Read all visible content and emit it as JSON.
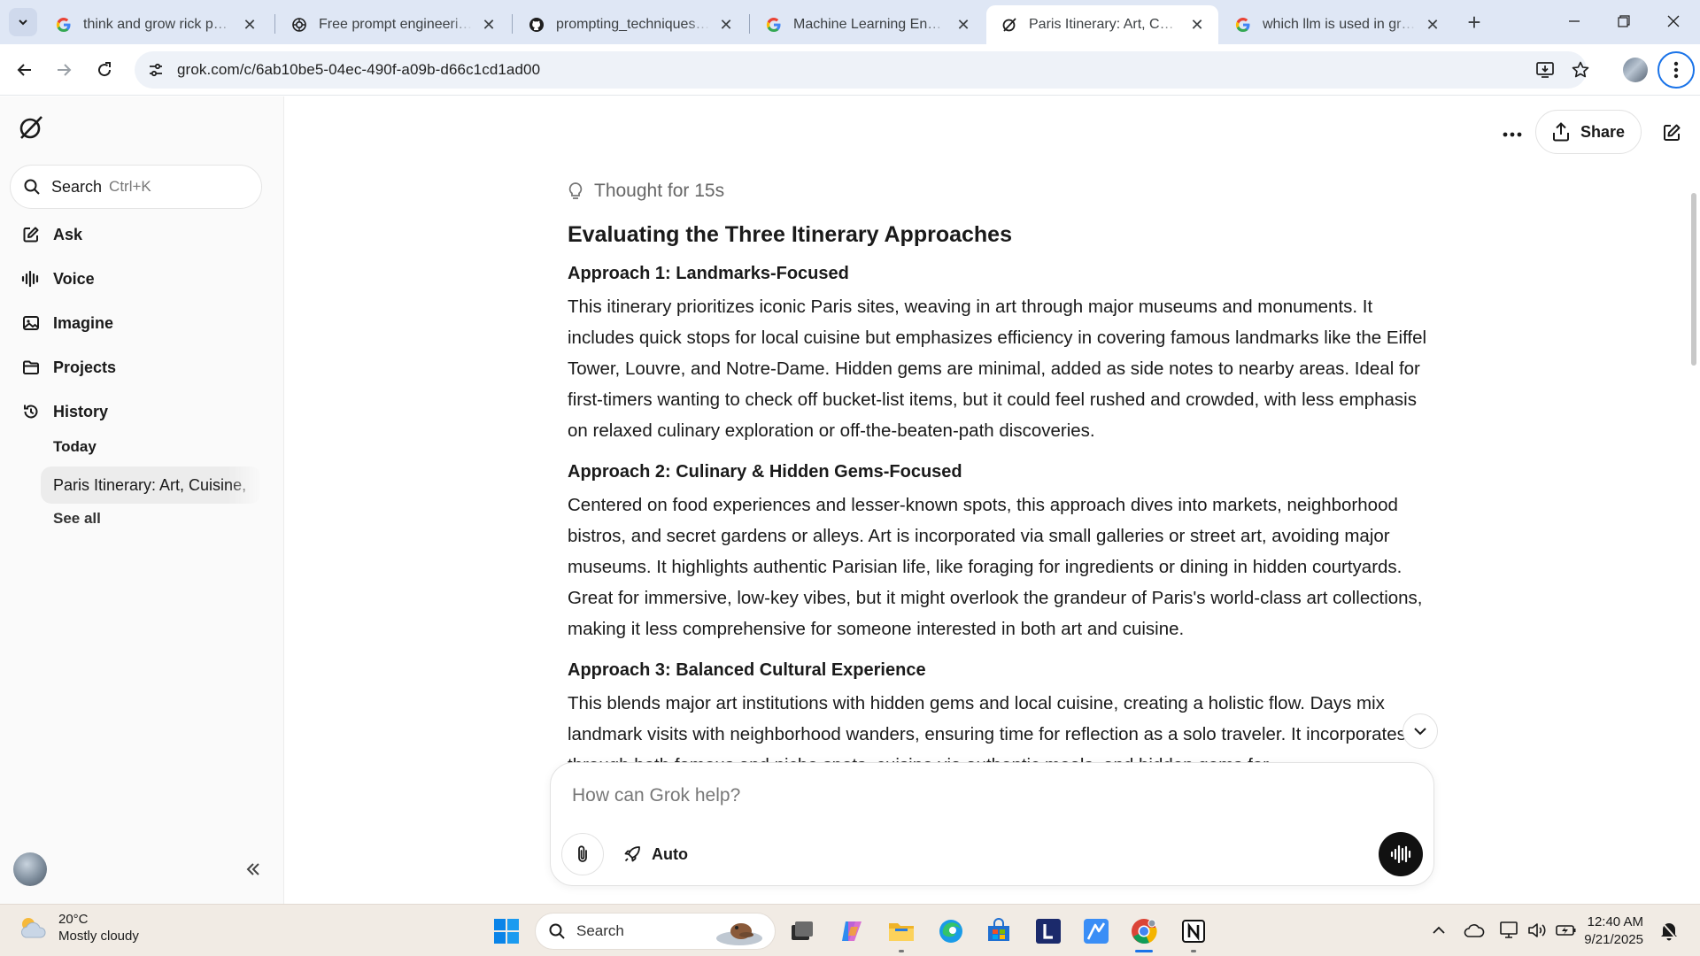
{
  "browser": {
    "tabs": [
      {
        "title": "think and grow rick pdf - G",
        "favicon": "google-icon"
      },
      {
        "title": "Free prompt engineering c",
        "favicon": "chatgpt-icon"
      },
      {
        "title": "prompting_techniques_on",
        "favicon": "github-icon"
      },
      {
        "title": "Machine Learning Enginee",
        "favicon": "google-icon"
      },
      {
        "title": "Paris Itinerary: Art, Cuisine,",
        "favicon": "grok-icon"
      },
      {
        "title": "which llm is used in grok -",
        "favicon": "google-icon"
      }
    ],
    "active_tab_index": 4,
    "url": "grok.com/c/6ab10be5-04ec-490f-a09b-d66c1cd1ad00"
  },
  "sidebar": {
    "search_label": "Search",
    "search_shortcut": "Ctrl+K",
    "nav": [
      {
        "label": "Ask",
        "icon": "ask-edit-icon"
      },
      {
        "label": "Voice",
        "icon": "voice-wave-icon"
      },
      {
        "label": "Imagine",
        "icon": "image-icon"
      },
      {
        "label": "Projects",
        "icon": "folder-icon"
      },
      {
        "label": "History",
        "icon": "history-icon"
      }
    ],
    "history": {
      "group": "Today",
      "items": [
        "Paris Itinerary: Art, Cuisine,"
      ],
      "see_all": "See all"
    }
  },
  "header": {
    "share_label": "Share"
  },
  "response": {
    "thought_label": "Thought for 15s",
    "heading": "Evaluating the Three Itinerary Approaches",
    "sections": [
      {
        "title": "Approach 1: Landmarks-Focused",
        "body": "This itinerary prioritizes iconic Paris sites, weaving in art through major museums and monuments. It includes quick stops for local cuisine but emphasizes efficiency in covering famous landmarks like the Eiffel Tower, Louvre, and Notre-Dame. Hidden gems are minimal, added as side notes to nearby areas. Ideal for first-timers wanting to check off bucket-list items, but it could feel rushed and crowded, with less emphasis on relaxed culinary exploration or off-the-beaten-path discoveries."
      },
      {
        "title": "Approach 2: Culinary & Hidden Gems-Focused",
        "body": "Centered on food experiences and lesser-known spots, this approach dives into markets, neighborhood bistros, and secret gardens or alleys. Art is incorporated via small galleries or street art, avoiding major museums. It highlights authentic Parisian life, like foraging for ingredients or dining in hidden courtyards. Great for immersive, low-key vibes, but it might overlook the grandeur of Paris's world-class art collections, making it less comprehensive for someone interested in both art and cuisine."
      },
      {
        "title": "Approach 3: Balanced Cultural Experience",
        "body": "This blends major art institutions with hidden gems and local cuisine, creating a holistic flow. Days mix landmark visits with neighborhood wanders, ensuring time for reflection as a solo traveler. It incorporates art through both famous and niche spots, cuisine via authentic meals, and hidden gems for"
      }
    ]
  },
  "composer": {
    "placeholder": "How can Grok help?",
    "mode_label": "Auto"
  },
  "taskbar": {
    "weather_temp": "20°C",
    "weather_desc": "Mostly cloudy",
    "search_label": "Search",
    "time": "12:40 AM",
    "date": "9/21/2025"
  },
  "colors": {
    "chrome_tabbar": "#dfe7f5",
    "accent_blue": "#1a73e8",
    "sidebar_bg": "#fafafa",
    "taskbar_bg": "#f1ebe4"
  }
}
